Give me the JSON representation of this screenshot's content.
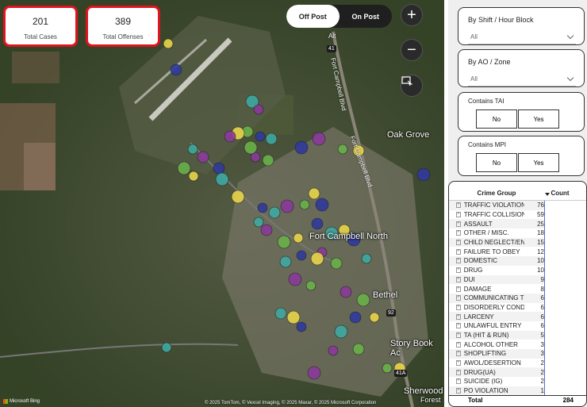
{
  "kpis": {
    "total_cases": {
      "value": "201",
      "label": "Total Cases"
    },
    "total_offenses": {
      "value": "389",
      "label": "Total Offenses"
    }
  },
  "toggle": {
    "off_label": "Off Post",
    "on_label": "On Post"
  },
  "map_controls": {
    "zoom_in": "+",
    "zoom_out": "−"
  },
  "map_labels": {
    "oak_grove": "Oak Grove",
    "fort_campbell_north": "Fort Campbell North",
    "bethel": "Bethel",
    "story_book": "Story Book Ac",
    "sherwood": "Sherwood",
    "forest": "Forest",
    "road1": "Fort Campbell Blvd",
    "road2": "Fort Campbell Blvd",
    "alt": "Alt",
    "shield_41": "41",
    "shield_41a": "41A",
    "shield_92": "92"
  },
  "attribution": {
    "bing": "Microsoft Bing",
    "copyright": "© 2025 TomTom, © Vexcel Imaging, © 2025 Maxar, © 2025 Microsoft Corporation"
  },
  "slicers": {
    "shift": {
      "title": "By Shift / Hour Block",
      "value": "All"
    },
    "ao_zone": {
      "title": "By AO / Zone",
      "value": "All"
    },
    "tai": {
      "title": "Contains TAI",
      "no": "No",
      "yes": "Yes"
    },
    "mpi": {
      "title": "Contains MPI",
      "no": "No",
      "yes": "Yes"
    }
  },
  "table": {
    "col1": "Crime Group",
    "col2": "Count",
    "rows": [
      {
        "name": "TRAFFIC VIOLATION",
        "count": "76"
      },
      {
        "name": "TRAFFIC COLLISION",
        "count": "59"
      },
      {
        "name": "ASSAULT",
        "count": "25"
      },
      {
        "name": "OTHER / MISC.",
        "count": "18"
      },
      {
        "name": "CHILD NEGLECT/ENDA...",
        "count": "15"
      },
      {
        "name": "FAILURE TO OBEY",
        "count": "12"
      },
      {
        "name": "DOMESTIC",
        "count": "10"
      },
      {
        "name": "DRUG",
        "count": "10"
      },
      {
        "name": "DUI",
        "count": "9"
      },
      {
        "name": "DAMAGE",
        "count": "8"
      },
      {
        "name": "COMMUNICATING TH...",
        "count": "6"
      },
      {
        "name": "DISORDERLY CONDUCT",
        "count": "6"
      },
      {
        "name": "LARCENY",
        "count": "6"
      },
      {
        "name": "UNLAWFUL ENTRY",
        "count": "6"
      },
      {
        "name": "TA (HIT & RUN)",
        "count": "5"
      },
      {
        "name": "ALCOHOL OTHER",
        "count": "3"
      },
      {
        "name": "SHOPLIFTING",
        "count": "3"
      },
      {
        "name": "AWOL/DESERTION",
        "count": "2"
      },
      {
        "name": "DRUG(UA)",
        "count": "2"
      },
      {
        "name": "SUICIDE (IG)",
        "count": "2"
      },
      {
        "name": "PO VIOLATION",
        "count": "1"
      }
    ],
    "total_label": "Total",
    "total_value": "284"
  },
  "colors": {
    "kpi_border": "#e0141e",
    "marker_yellow": "#e8d44a",
    "marker_blue": "#2f3a9c",
    "marker_teal": "#3fa8a0",
    "marker_purple": "#8a3a9a",
    "marker_green": "#6bb04a"
  }
}
